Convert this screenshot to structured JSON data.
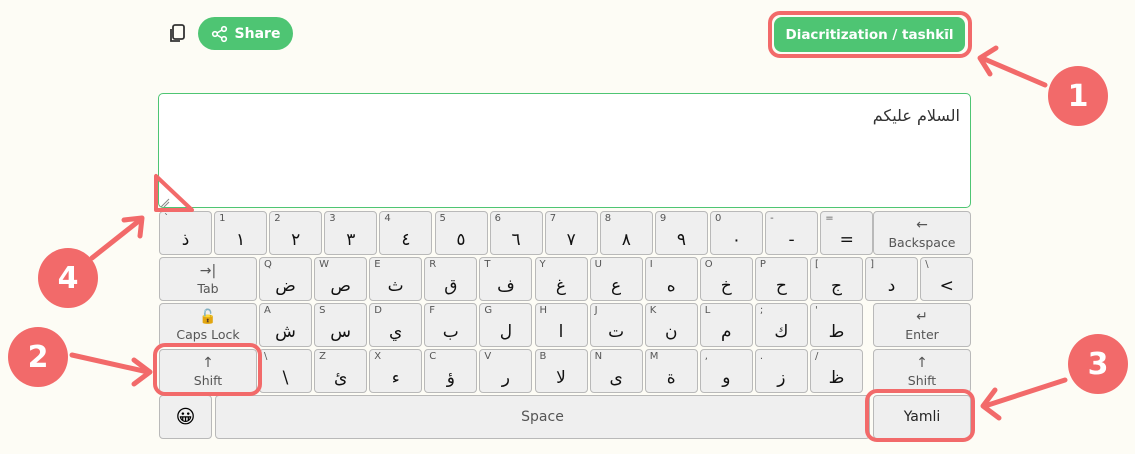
{
  "toolbar": {
    "copy_icon": "copy-icon",
    "share_icon": "share-icon",
    "share_label": "Share",
    "diacritization_label": "Diacritization / tashkīl"
  },
  "editor": {
    "text": "السلام عليكم"
  },
  "keyboard": {
    "row1": [
      {
        "sm": "`",
        "ar": "ذ"
      },
      {
        "sm": "1",
        "ar": "١"
      },
      {
        "sm": "2",
        "ar": "٢"
      },
      {
        "sm": "3",
        "ar": "٣"
      },
      {
        "sm": "4",
        "ar": "٤"
      },
      {
        "sm": "5",
        "ar": "٥"
      },
      {
        "sm": "6",
        "ar": "٦"
      },
      {
        "sm": "7",
        "ar": "٧"
      },
      {
        "sm": "8",
        "ar": "٨"
      },
      {
        "sm": "9",
        "ar": "٩"
      },
      {
        "sm": "0",
        "ar": "٠"
      },
      {
        "sm": "-",
        "ar": "-"
      },
      {
        "sm": "=",
        "ar": "="
      }
    ],
    "backspace": {
      "icon": "←",
      "label": "Backspace"
    },
    "tab": {
      "icon": "→|",
      "label": "Tab"
    },
    "row2": [
      {
        "sm": "Q",
        "ar": "ض"
      },
      {
        "sm": "W",
        "ar": "ص"
      },
      {
        "sm": "E",
        "ar": "ث"
      },
      {
        "sm": "R",
        "ar": "ق"
      },
      {
        "sm": "T",
        "ar": "ف"
      },
      {
        "sm": "Y",
        "ar": "غ"
      },
      {
        "sm": "U",
        "ar": "ع"
      },
      {
        "sm": "I",
        "ar": "ه"
      },
      {
        "sm": "O",
        "ar": "خ"
      },
      {
        "sm": "P",
        "ar": "ح"
      },
      {
        "sm": "[",
        "ar": "ج"
      },
      {
        "sm": "]",
        "ar": "د"
      },
      {
        "sm": "\\",
        "ar": "<"
      }
    ],
    "capslock": {
      "icon": "🔓",
      "label": "Caps Lock"
    },
    "row3": [
      {
        "sm": "A",
        "ar": "ش"
      },
      {
        "sm": "S",
        "ar": "س"
      },
      {
        "sm": "D",
        "ar": "ي"
      },
      {
        "sm": "F",
        "ar": "ب"
      },
      {
        "sm": "G",
        "ar": "ل"
      },
      {
        "sm": "H",
        "ar": "ا"
      },
      {
        "sm": "J",
        "ar": "ت"
      },
      {
        "sm": "K",
        "ar": "ن"
      },
      {
        "sm": "L",
        "ar": "م"
      },
      {
        "sm": ";",
        "ar": "ك"
      },
      {
        "sm": "'",
        "ar": "ط"
      }
    ],
    "enter": {
      "icon": "↵",
      "label": "Enter"
    },
    "shift": {
      "icon": "↑",
      "label": "Shift"
    },
    "row4": [
      {
        "sm": "\\",
        "ar": "\\"
      },
      {
        "sm": "Z",
        "ar": "ئ"
      },
      {
        "sm": "X",
        "ar": "ء"
      },
      {
        "sm": "C",
        "ar": "ؤ"
      },
      {
        "sm": "V",
        "ar": "ر"
      },
      {
        "sm": "B",
        "ar": "لا"
      },
      {
        "sm": "N",
        "ar": "ى"
      },
      {
        "sm": "M",
        "ar": "ة"
      },
      {
        "sm": ",",
        "ar": "و"
      },
      {
        "sm": ".",
        "ar": "ز"
      },
      {
        "sm": "/",
        "ar": "ظ"
      }
    ],
    "emoji": "😀",
    "space_label": "Space",
    "yamli_label": "Yamli"
  },
  "annotations": {
    "badge1": "1",
    "badge2": "2",
    "badge3": "3",
    "badge4": "4",
    "color": "#f26a6a"
  }
}
